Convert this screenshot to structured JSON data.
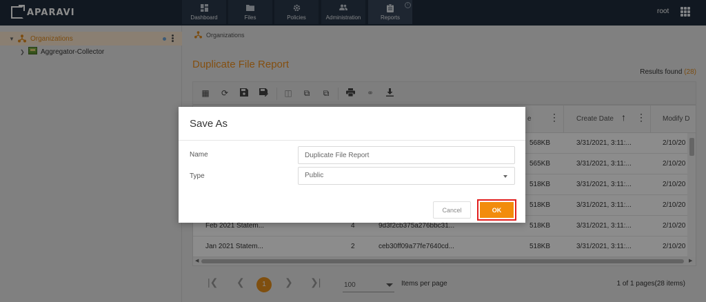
{
  "app": {
    "logo_text": "APARAVI",
    "user": "root"
  },
  "nav": {
    "tabs": [
      {
        "label": "Dashboard"
      },
      {
        "label": "Files"
      },
      {
        "label": "Policies"
      },
      {
        "label": "Administration"
      },
      {
        "label": "Reports",
        "active": true
      }
    ]
  },
  "sidebar": {
    "items": [
      {
        "label": "Organizations",
        "selected": true,
        "icon": "organization-icon"
      },
      {
        "label": "Aggregator-Collector",
        "icon": "aggregator-icon"
      }
    ]
  },
  "breadcrumb": {
    "label": "Organizations"
  },
  "report": {
    "title": "Duplicate File Report",
    "results_label": "Results found",
    "results_count": "(28)"
  },
  "toolbar": {
    "icons": [
      "table-icon",
      "refresh-icon",
      "save-icon",
      "save-as-icon",
      "grid-split-icon",
      "copy-icon",
      "copy-alt-icon",
      "print-icon",
      "link-icon",
      "download-icon"
    ]
  },
  "grid": {
    "headers": {
      "size_partial": "e",
      "create_date": "Create Date",
      "modify_partial": "Modify D"
    },
    "rows": [
      {
        "size": "568KB",
        "create": "3/31/2021, 3:11:...",
        "modify": "2/10/20"
      },
      {
        "size": "565KB",
        "create": "3/31/2021, 3:11:...",
        "modify": "2/10/20"
      },
      {
        "size": "518KB",
        "create": "3/31/2021, 3:11:...",
        "modify": "2/10/20"
      },
      {
        "size": "518KB",
        "create": "3/31/2021, 3:11:...",
        "modify": "2/10/20"
      },
      {
        "name": "Feb 2021 Statem...",
        "count": "4",
        "hash": "9d3f2cb375a276bbc31...",
        "size": "518KB",
        "create": "3/31/2021, 3:11:...",
        "modify": "2/10/20"
      },
      {
        "name": "Jan 2021 Statem...",
        "count": "2",
        "hash": "ceb30ff09a77fe7640cd...",
        "size": "518KB",
        "create": "3/31/2021, 3:11:...",
        "modify": "2/10/20"
      }
    ]
  },
  "pager": {
    "current_page": "1",
    "page_size": "100",
    "items_per_page_label": "Items per page",
    "info": "1 of 1 pages(28 items)"
  },
  "dialog": {
    "title": "Save As",
    "name_label": "Name",
    "name_value": "Duplicate File Report",
    "type_label": "Type",
    "type_value": "Public",
    "cancel_label": "Cancel",
    "ok_label": "OK",
    "ok_highlight_color": "#e11d1d",
    "accent": "#f28c0c"
  }
}
